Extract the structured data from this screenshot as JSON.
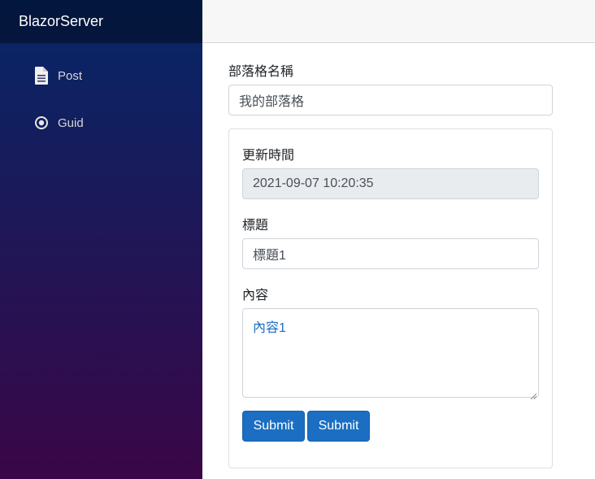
{
  "app": {
    "brand": "BlazorServer"
  },
  "sidebar": {
    "items": [
      {
        "label": "Post",
        "icon": "document-icon"
      },
      {
        "label": "Guid",
        "icon": "radio-circle-icon"
      }
    ]
  },
  "form": {
    "blog_name_label": "部落格名稱",
    "blog_name_value": "我的部落格",
    "updated_label": "更新時間",
    "updated_value": "2021-09-07 10:20:35",
    "title_label": "標題",
    "title_value": "標題1",
    "content_label": "內容",
    "content_value": "內容1",
    "submit_label_1": "Submit",
    "submit_label_2": "Submit"
  },
  "colors": {
    "sidebar_top": "#052767",
    "sidebar_bottom": "#3a0647",
    "primary": "#1b6ec2"
  }
}
